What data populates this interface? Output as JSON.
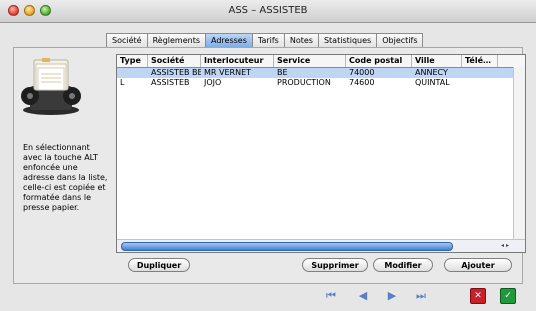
{
  "window": {
    "title": "ASS – ASSISTEB"
  },
  "tabs": [
    "Société",
    "Règlements",
    "Adresses",
    "Tarifs",
    "Notes",
    "Statistiques",
    "Objectifs"
  ],
  "active_tab": "Adresses",
  "hint": "En sélectionnant avec la touche ALT enfoncée une adresse dans la liste, celle-ci est copiée et formatée dans le presse papier.",
  "table": {
    "columns": [
      "Type",
      "Société",
      "Interlocuteur",
      "Service",
      "Code postal",
      "Ville",
      "Télé…"
    ],
    "rows": [
      [
        "",
        "ASSISTEB BE",
        "MR VERNET",
        "BE",
        "74000",
        "ANNECY",
        ""
      ],
      [
        "L",
        "ASSISTEB",
        "JOJO",
        "PRODUCTION",
        "74600",
        "QUINTAL",
        ""
      ]
    ],
    "selected_row": 0
  },
  "buttons": {
    "duplicate": "Dupliquer",
    "delete": "Supprimer",
    "modify": "Modifier",
    "add": "Ajouter"
  },
  "icons": {
    "first": "first-record-icon",
    "prev": "previous-record-icon",
    "next": "next-record-icon",
    "last": "last-record-icon",
    "cancel": "cancel-icon",
    "save": "save-icon"
  },
  "colors": {
    "selection": "#bed5f3",
    "active_tab": "#7faee6",
    "scroll_thumb": "#3f7fd2"
  }
}
